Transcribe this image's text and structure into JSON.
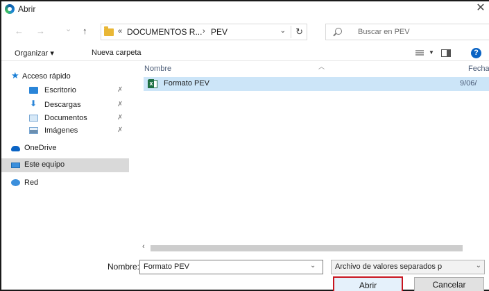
{
  "window": {
    "title": "Abrir",
    "close_glyph": "✕"
  },
  "address": {
    "back_glyph": "←",
    "forward_glyph": "→",
    "recent_glyph": "⌄",
    "up_glyph": "↑",
    "overflow": "«",
    "crumbs": [
      "DOCUMENTOS R...",
      "PEV"
    ],
    "separator": "›",
    "dropdown_glyph": "⌄",
    "refresh_glyph": "↻"
  },
  "search": {
    "placeholder": "Buscar en PEV"
  },
  "toolbar": {
    "organize": "Organizar ▾",
    "new_folder": "Nueva carpeta",
    "help": "?"
  },
  "nav": {
    "items": [
      {
        "label": "Acceso rápido",
        "icon": "star-icon"
      },
      {
        "label": "Escritorio",
        "icon": "desktop-icon",
        "pinned": true
      },
      {
        "label": "Descargas",
        "icon": "download-icon",
        "pinned": true
      },
      {
        "label": "Documentos",
        "icon": "documents-icon",
        "pinned": true
      },
      {
        "label": "Imágenes",
        "icon": "pictures-icon",
        "pinned": true
      },
      {
        "label": "OneDrive",
        "icon": "cloud-icon"
      },
      {
        "label": "Este equipo",
        "icon": "computer-icon",
        "selected": true
      },
      {
        "label": "Red",
        "icon": "network-icon"
      }
    ],
    "pin_glyph": "📌"
  },
  "filelist": {
    "columns": {
      "name": "Nombre",
      "date": "Fecha"
    },
    "files": [
      {
        "name": "Formato PEV",
        "date": "9/06/"
      }
    ]
  },
  "bottom": {
    "name_label": "Nombre:",
    "name_value": "Formato PEV",
    "filter": "Archivo de valores separados p",
    "open": "Abrir",
    "cancel": "Cancelar"
  },
  "colors": {
    "selection": "#cce5f8",
    "accent": "#0a63c4",
    "highlight_border": "#c8141e"
  }
}
